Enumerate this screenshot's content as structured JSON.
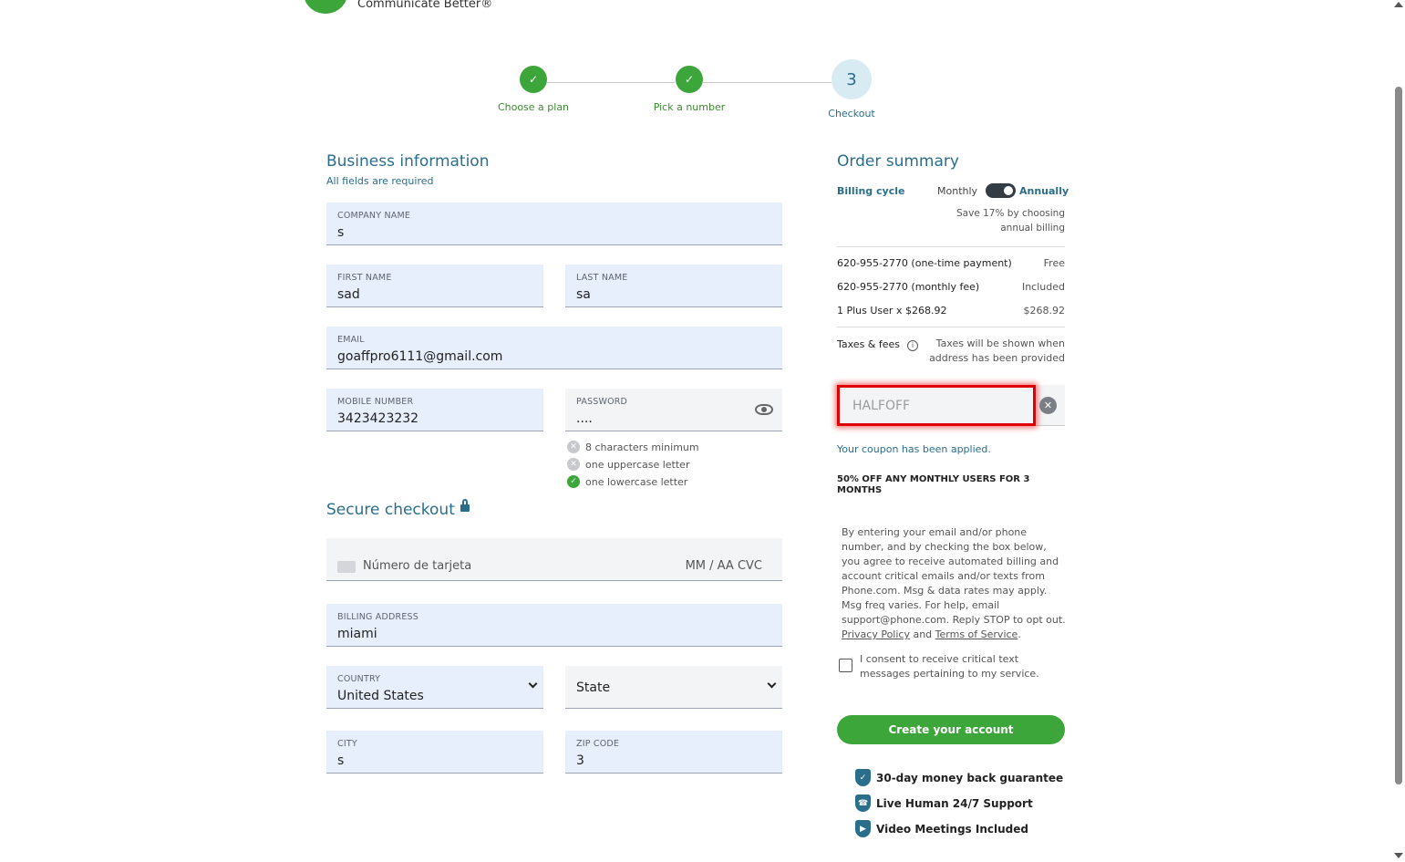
{
  "header": {
    "tagline": "Communicate Better®"
  },
  "stepper": {
    "steps": [
      {
        "label": "Choose a plan",
        "state": "done"
      },
      {
        "label": "Pick a number",
        "state": "done"
      },
      {
        "label": "Checkout",
        "number": "3",
        "state": "current"
      }
    ]
  },
  "business": {
    "title": "Business information",
    "note": "All fields are required",
    "company_label": "COMPANY NAME",
    "company_value": "s",
    "first_label": "FIRST NAME",
    "first_value": "sad",
    "last_label": "LAST NAME",
    "last_value": "sa",
    "email_label": "EMAIL",
    "email_value": "goaffpro6111@gmail.com",
    "mobile_label": "MOBILE NUMBER",
    "mobile_value": "3423423232",
    "password_label": "PASSWORD",
    "password_value": "....",
    "password_rules": [
      {
        "text": "8 characters minimum",
        "met": false
      },
      {
        "text": "one uppercase letter",
        "met": false
      },
      {
        "text": "one lowercase letter",
        "met": true
      }
    ]
  },
  "checkout": {
    "title": "Secure checkout",
    "card_placeholder": "Número de tarjeta",
    "card_exp_cvc": "MM / AA  CVC",
    "billing_label": "BILLING ADDRESS",
    "billing_value": "miami",
    "country_label": "COUNTRY",
    "country_value": "United States",
    "state_value": "State",
    "city_label": "CITY",
    "city_value": "s",
    "zip_label": "ZIP CODE",
    "zip_value": "3"
  },
  "order": {
    "title": "Order summary",
    "billing_cycle": "Billing cycle",
    "monthly": "Monthly",
    "annually": "Annually",
    "save_note_1": "Save 17% by choosing",
    "save_note_2": "annual billing",
    "items": [
      {
        "label": "620-955-2770 (one-time payment)",
        "value": "Free"
      },
      {
        "label": "620-955-2770 (monthly fee)",
        "value": "Included"
      },
      {
        "label": "1 Plus User x $268.92",
        "value": "$268.92"
      }
    ],
    "taxes_label": "Taxes & fees",
    "taxes_note_1": "Taxes will be shown when",
    "taxes_note_2": "address has been provided",
    "coupon_value": "HALFOFF",
    "coupon_msg": "Your coupon has been applied.",
    "promo": "50% OFF ANY MONTHLY USERS FOR 3 MONTHS",
    "legal_text": "By entering your email and/or phone number, and by checking the box below, you agree to receive automated billing and account critical emails and/or texts from Phone.com. Msg & data rates may apply. Msg freq varies. For help, email support@phone.com. Reply STOP to opt out.",
    "privacy": "Privacy Policy",
    "and": "and",
    "terms": "Terms of Service",
    "consent": "I consent to receive critical text messages pertaining to my service.",
    "create_btn": "Create your account",
    "perks": [
      "30-day money back guarantee",
      "Live Human 24/7 Support",
      "Video Meetings Included"
    ]
  },
  "colors": {
    "accent": "#2a6e8c",
    "green": "#3da63a",
    "field_bg": "#e8effc",
    "highlight": "#e00000"
  }
}
